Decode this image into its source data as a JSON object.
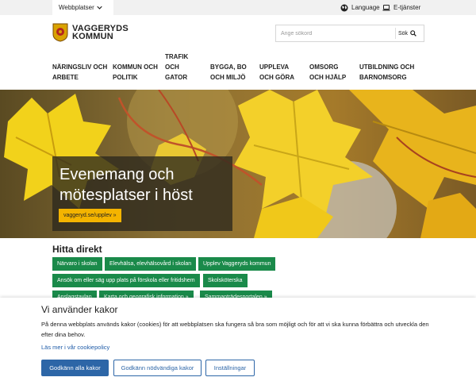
{
  "utility_bar": {
    "site_select": "Webbplatser",
    "language": "Language",
    "eservices": "E-tjänster"
  },
  "header": {
    "logo_line1": "VAGGERYDS",
    "logo_line2": "KOMMUN",
    "search_placeholder": "Ange sökord",
    "search_button": "Sök"
  },
  "nav": [
    {
      "line1": "Näringsliv och",
      "line2": "arbete"
    },
    {
      "line1": "Kommun och",
      "line2": "politik"
    },
    {
      "line1": "Trafik",
      "line2": "och",
      "line3": "gator"
    },
    {
      "line1": "Bygga, bo",
      "line2": "och miljö"
    },
    {
      "line1": "Uppleva",
      "line2": "och göra"
    },
    {
      "line1": "Omsorg",
      "line2": "och hjälp"
    },
    {
      "line1": "Utbildning och",
      "line2": "barnomsorg"
    }
  ],
  "hero": {
    "title": "Evenemang och mötesplatser i höst",
    "link": "vaggeryd.se/upplev »"
  },
  "hitta": {
    "title": "Hitta direkt",
    "links": [
      "Närvaro i skolan",
      "Elevhälsa, elevhälsovård i skolan",
      "Upplev Vaggeryds kommun",
      "Ansök om eller säg upp plats på förskola eller fritidshem",
      "Skolsköterska",
      "Anslagstavlan",
      "Karta och geografisk information »",
      "Sammanträdesportalen »"
    ]
  },
  "cookie": {
    "title": "Vi använder kakor",
    "text": "På denna webbplats används kakor (cookies) för att webbplatsen ska fungera så bra som möjligt och för att vi ska kunna förbättra och utveckla den efter dina behov.",
    "policy_link": "Läs mer i vår cookiepolicy",
    "accept_all": "Godkänn alla kakor",
    "accept_necessary": "Godkänn nödvändiga kakor",
    "settings": "Inställningar"
  },
  "colors": {
    "accent_green": "#1a8a4a",
    "primary_blue": "#2d66a7",
    "hero_link_yellow": "#f4b400"
  }
}
